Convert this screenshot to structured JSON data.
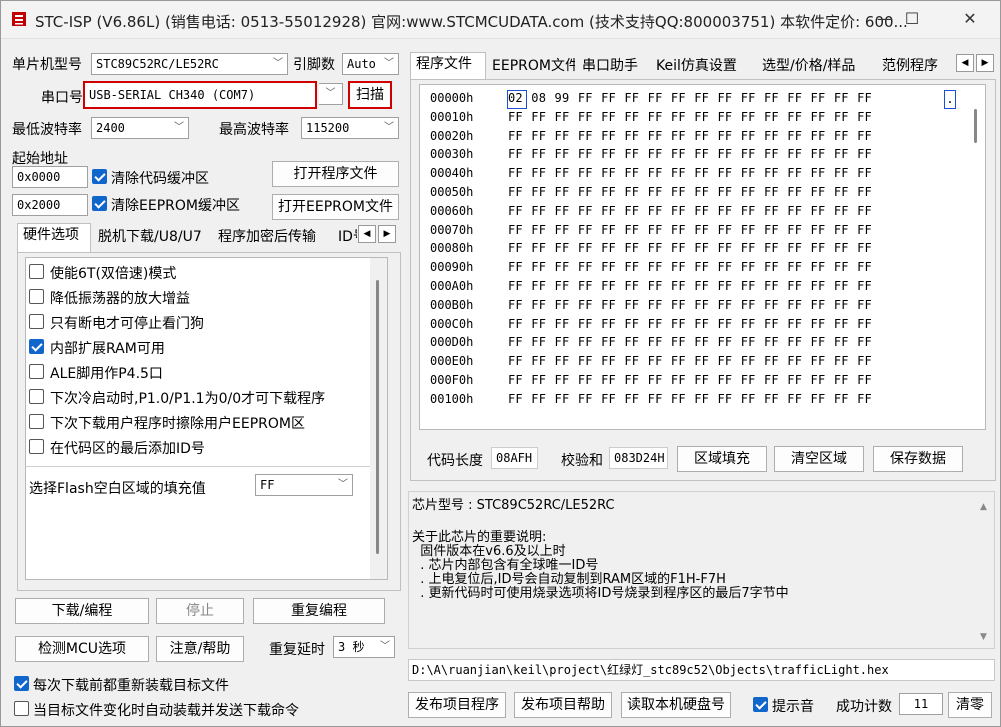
{
  "window": {
    "title": "STC-ISP (V6.86L) (销售电话: 0513-55012928) 官网:www.STCMCUDATA.com  (技术支持QQ:800003751) 本软件定价: 600...",
    "minimize": "—",
    "maximize": "☐",
    "close": "✕"
  },
  "left": {
    "mcu_label": "单片机型号",
    "mcu_value": "STC89C52RC/LE52RC",
    "pins_label": "引脚数",
    "pins_value": "Auto",
    "port_label": "串口号",
    "port_value": "USB-SERIAL CH340 (COM7)",
    "scan_button": "扫描",
    "min_baud_label": "最低波特率",
    "min_baud_value": "2400",
    "max_baud_label": "最高波特率",
    "max_baud_value": "115200",
    "start_addr_label": "起始地址",
    "addr1": "0x0000",
    "clear_code_label": "清除代码缓冲区",
    "open_prog_button": "打开程序文件",
    "addr2": "0x2000",
    "clear_eeprom_label": "清除EEPROM缓冲区",
    "open_eeprom_button": "打开EEPROM文件",
    "tabs": [
      "硬件选项",
      "脱机下载/U8/U7",
      "程序加密后传输",
      "ID号"
    ],
    "options": [
      {
        "label": "使能6T(双倍速)模式",
        "checked": false
      },
      {
        "label": "降低振荡器的放大增益",
        "checked": false
      },
      {
        "label": "只有断电才可停止看门狗",
        "checked": false
      },
      {
        "label": "内部扩展RAM可用",
        "checked": true
      },
      {
        "label": "ALE脚用作P4.5口",
        "checked": false
      },
      {
        "label": "下次冷启动时,P1.0/P1.1为0/0才可下载程序",
        "checked": false
      },
      {
        "label": "下次下载用户程序时擦除用户EEPROM区",
        "checked": false
      },
      {
        "label": "在代码区的最后添加ID号",
        "checked": false
      }
    ],
    "fill_label": "选择Flash空白区域的填充值",
    "fill_value": "FF",
    "download_button": "下载/编程",
    "stop_button": "停止",
    "repeat_button": "重复编程",
    "check_mcu_button": "检测MCU选项",
    "help_button": "注意/帮助",
    "repeat_delay_label": "重复延时",
    "repeat_delay_value": "3 秒",
    "reload_label": "每次下载前都重新装载目标文件",
    "auto_send_label": "当目标文件变化时自动装载并发送下载命令"
  },
  "right": {
    "tabs": [
      "程序文件",
      "EEPROM文件",
      "串口助手",
      "Keil仿真设置",
      "选型/价格/样品",
      "范例程序"
    ],
    "hex_rows": [
      {
        "addr": "00000h",
        "bytes": "02 08 99 FF FF FF FF FF FF FF FF FF FF FF FF FF"
      },
      {
        "addr": "00010h",
        "bytes": "FF FF FF FF FF FF FF FF FF FF FF FF FF FF FF FF"
      },
      {
        "addr": "00020h",
        "bytes": "FF FF FF FF FF FF FF FF FF FF FF FF FF FF FF FF"
      },
      {
        "addr": "00030h",
        "bytes": "FF FF FF FF FF FF FF FF FF FF FF FF FF FF FF FF"
      },
      {
        "addr": "00040h",
        "bytes": "FF FF FF FF FF FF FF FF FF FF FF FF FF FF FF FF"
      },
      {
        "addr": "00050h",
        "bytes": "FF FF FF FF FF FF FF FF FF FF FF FF FF FF FF FF"
      },
      {
        "addr": "00060h",
        "bytes": "FF FF FF FF FF FF FF FF FF FF FF FF FF FF FF FF"
      },
      {
        "addr": "00070h",
        "bytes": "FF FF FF FF FF FF FF FF FF FF FF FF FF FF FF FF"
      },
      {
        "addr": "00080h",
        "bytes": "FF FF FF FF FF FF FF FF FF FF FF FF FF FF FF FF"
      },
      {
        "addr": "00090h",
        "bytes": "FF FF FF FF FF FF FF FF FF FF FF FF FF FF FF FF"
      },
      {
        "addr": "000A0h",
        "bytes": "FF FF FF FF FF FF FF FF FF FF FF FF FF FF FF FF"
      },
      {
        "addr": "000B0h",
        "bytes": "FF FF FF FF FF FF FF FF FF FF FF FF FF FF FF FF"
      },
      {
        "addr": "000C0h",
        "bytes": "FF FF FF FF FF FF FF FF FF FF FF FF FF FF FF FF"
      },
      {
        "addr": "000D0h",
        "bytes": "FF FF FF FF FF FF FF FF FF FF FF FF FF FF FF FF"
      },
      {
        "addr": "000E0h",
        "bytes": "FF FF FF FF FF FF FF FF FF FF FF FF FF FF FF FF"
      },
      {
        "addr": "000F0h",
        "bytes": "FF FF FF FF FF FF FF FF FF FF FF FF FF FF FF FF"
      },
      {
        "addr": "00100h",
        "bytes": "FF FF FF FF FF FF FF FF FF FF FF FF FF FF FF FF"
      }
    ],
    "ascii_first": ".",
    "code_len_label": "代码长度",
    "code_len_value": "08AFH",
    "checksum_label": "校验和",
    "checksum_value": "083D24H",
    "fill_area_button": "区域填充",
    "clear_area_button": "清空区域",
    "save_data_button": "保存数据",
    "info_lines": [
      "芯片型号 : STC89C52RC/LE52RC",
      "",
      "关于此芯片的重要说明:",
      "  固件版本在v6.6及以上时",
      "  . 芯片内部包含有全球唯一ID号",
      "  . 上电复位后,ID号会自动复制到RAM区域的F1H-F7H",
      "  . 更新代码时可使用烧录选项将ID号烧录到程序区的最后7字节中"
    ],
    "file_path": "D:\\A\\ruanjian\\keil\\project\\红绿灯_stc89c52\\Objects\\trafficLight.hex",
    "publish_button": "发布项目程序",
    "publish_help_button": "发布项目帮助",
    "read_disk_button": "读取本机硬盘号",
    "beep_label": "提示音",
    "success_label": "成功计数",
    "success_value": "11",
    "clear_count_button": "清零"
  }
}
